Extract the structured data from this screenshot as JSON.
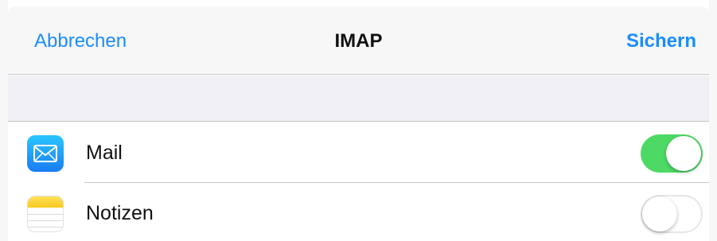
{
  "nav": {
    "cancel_label": "Abbrechen",
    "title": "IMAP",
    "save_label": "Sichern"
  },
  "settings": [
    {
      "label": "Mail",
      "icon": "mail-icon",
      "enabled": true
    },
    {
      "label": "Notizen",
      "icon": "notes-icon",
      "enabled": false
    }
  ],
  "colors": {
    "accent": "#1a8cff",
    "toggle_on": "#4cd964",
    "toggle_off": "#e5e5ea",
    "background": "#efeff4"
  }
}
